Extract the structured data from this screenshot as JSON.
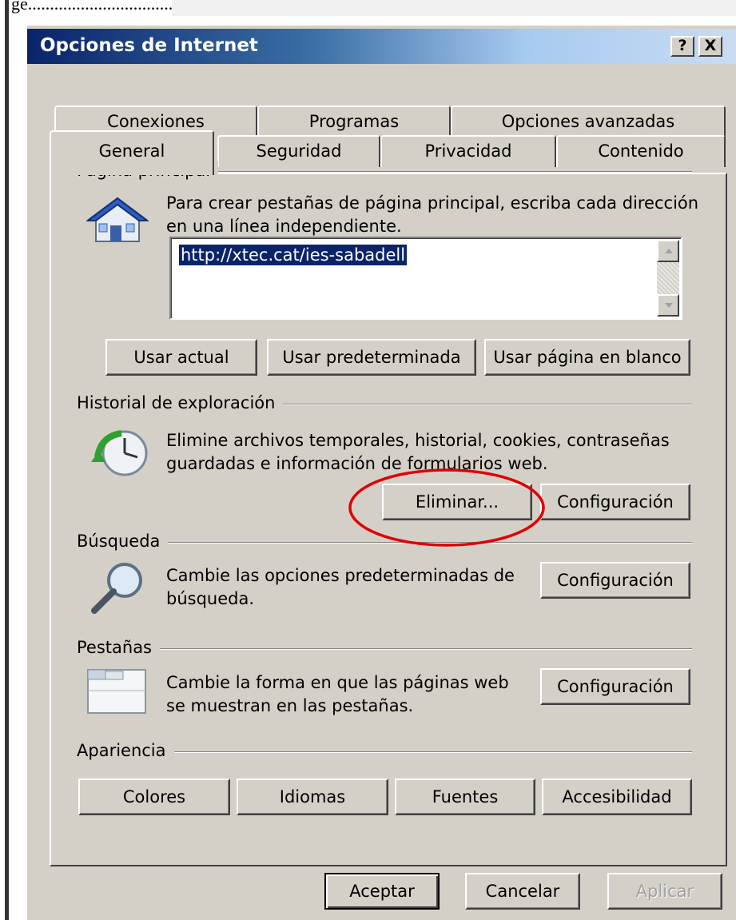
{
  "background_fragment": "ge.................................",
  "window": {
    "title": "Opciones de Internet",
    "help_glyph": "?",
    "close_glyph": "X"
  },
  "tabs": {
    "back_row": [
      "Conexiones",
      "Programas",
      "Opciones avanzadas"
    ],
    "front_row": [
      "General",
      "Seguridad",
      "Privacidad",
      "Contenido"
    ],
    "active": "General"
  },
  "home_page": {
    "section_title": "Página principal",
    "description_line1": "Para crear pestañas de página principal, escriba cada dirección",
    "description_line2": "en una línea independiente.",
    "url_value": "http://xtec.cat/ies-sabadell",
    "icon": "house-icon",
    "buttons": {
      "use_current": "Usar actual",
      "use_default": "Usar predeterminada",
      "use_blank": "Usar página en blanco"
    }
  },
  "history": {
    "section_title": "Historial de exploración",
    "description_line1": "Elimine archivos temporales, historial, cookies, contraseñas",
    "description_line2": "guardadas e información de formularios web.",
    "icon": "history-clock-icon",
    "buttons": {
      "delete": "Eliminar...",
      "settings": "Configuración"
    }
  },
  "search": {
    "section_title": "Búsqueda",
    "description_line1": "Cambie las opciones predeterminadas de",
    "description_line2": "búsqueda.",
    "icon": "magnifier-icon",
    "buttons": {
      "settings": "Configuración"
    }
  },
  "tabs_section": {
    "section_title": "Pestañas",
    "description_line1": "Cambie la forma en que las páginas web",
    "description_line2": "se muestran en las pestañas.",
    "icon": "tabs-window-icon",
    "buttons": {
      "settings": "Configuración"
    }
  },
  "appearance": {
    "section_title": "Apariencia",
    "buttons": {
      "colors": "Colores",
      "languages": "Idiomas",
      "fonts": "Fuentes",
      "accessibility": "Accesibilidad"
    }
  },
  "footer_buttons": {
    "ok": "Aceptar",
    "cancel": "Cancelar",
    "apply": "Aplicar"
  },
  "colors": {
    "dialog_face": "#d4d0c8",
    "title_start": "#0a246a",
    "selection": "#0a246a",
    "annotation": "#e00000"
  }
}
